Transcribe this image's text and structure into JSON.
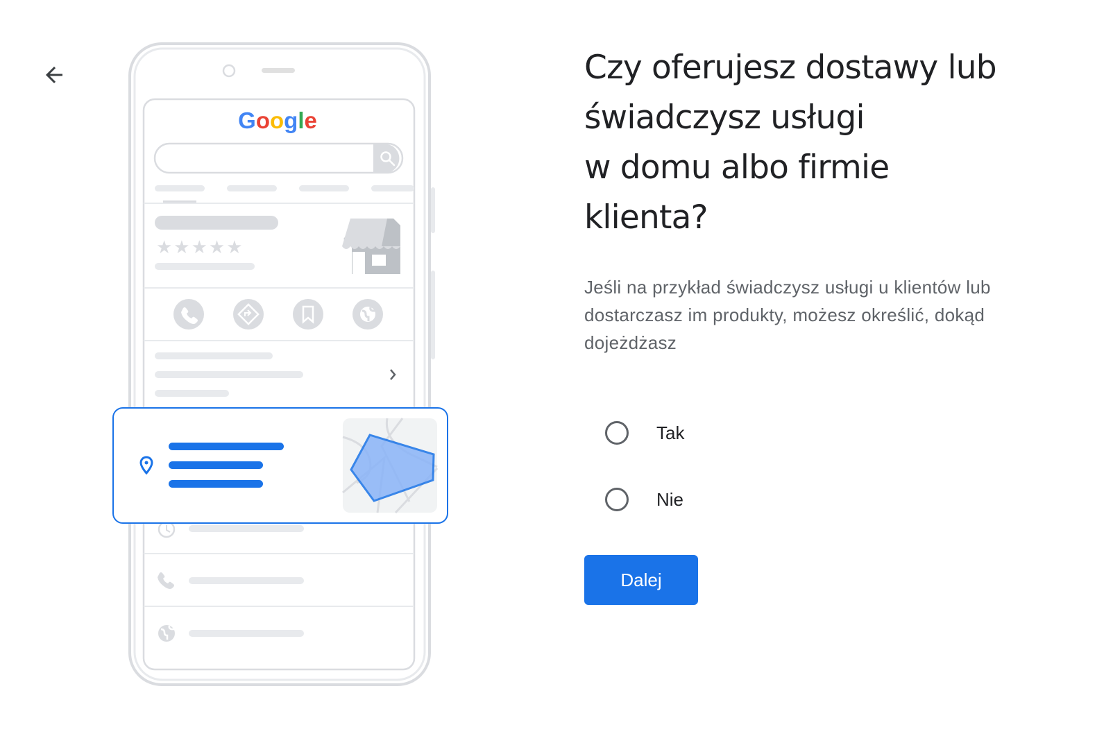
{
  "nav": {
    "back_icon": "arrow-back-icon"
  },
  "illustration": {
    "logo_text": "Google",
    "brand_colors": {
      "blue": "#4285F4",
      "red": "#EA4335",
      "yellow": "#FBBC05",
      "green": "#34A853"
    },
    "accent": "#1a73e8"
  },
  "question": {
    "title_lines": [
      "Czy oferujesz dostawy lub",
      "świadczysz usługi",
      "w domu albo firmie",
      "klienta?"
    ],
    "description": "Jeśli na przykład świadczysz usługi u klientów lub dostarczasz im produkty, możesz określić, dokąd dojeżdżasz"
  },
  "options": [
    {
      "label": "Tak",
      "selected": false
    },
    {
      "label": "Nie",
      "selected": false
    }
  ],
  "actions": {
    "next_label": "Dalej"
  }
}
